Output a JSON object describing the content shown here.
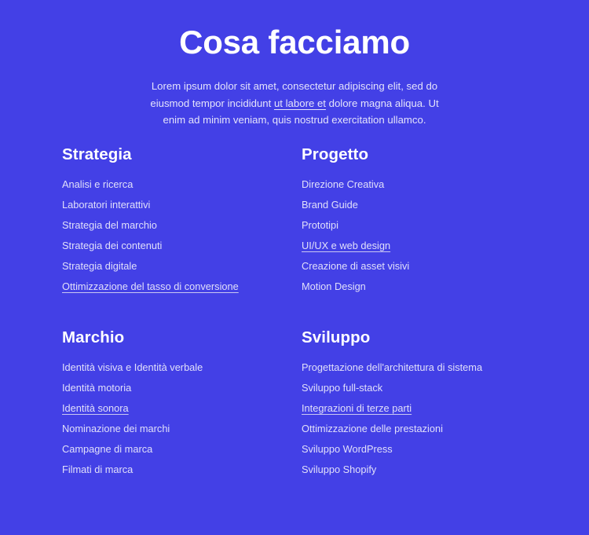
{
  "header": {
    "title": "Cosa facciamo",
    "intro_before": "Lorem ipsum dolor sit amet, consectetur adipiscing elit, sed do eiusmod tempor incididunt ",
    "intro_link": "ut labore et",
    "intro_after": " dolore magna aliqua. Ut enim ad minim veniam, quis nostrud exercitation ullamco."
  },
  "colors": {
    "background": "#4340e6",
    "heading_text": "#ffffff",
    "body_text": "#e4e3fb",
    "item_text": "#e0dffa",
    "underline": "#c9c7f2"
  },
  "groups": [
    {
      "title": "Strategia",
      "items": [
        {
          "label": "Analisi e ricerca",
          "underlined": false
        },
        {
          "label": "Laboratori interattivi",
          "underlined": false
        },
        {
          "label": "Strategia del marchio",
          "underlined": false
        },
        {
          "label": "Strategia dei contenuti",
          "underlined": false
        },
        {
          "label": "Strategia digitale",
          "underlined": false
        },
        {
          "label": "Ottimizzazione del tasso di conversione",
          "underlined": true
        }
      ]
    },
    {
      "title": "Progetto",
      "items": [
        {
          "label": "Direzione Creativa",
          "underlined": false
        },
        {
          "label": "Brand Guide",
          "underlined": false
        },
        {
          "label": "Prototipi",
          "underlined": false
        },
        {
          "label": "UI/UX e web design",
          "underlined": true
        },
        {
          "label": "Creazione di asset visivi",
          "underlined": false
        },
        {
          "label": "Motion Design",
          "underlined": false
        }
      ]
    },
    {
      "title": "Marchio",
      "items": [
        {
          "label": "Identità visiva e Identità verbale",
          "underlined": false
        },
        {
          "label": "Identità motoria",
          "underlined": false
        },
        {
          "label": "Identità sonora",
          "underlined": true
        },
        {
          "label": "Nominazione dei marchi",
          "underlined": false
        },
        {
          "label": "Campagne di marca",
          "underlined": false
        },
        {
          "label": "Filmati di marca",
          "underlined": false
        }
      ]
    },
    {
      "title": "Sviluppo",
      "items": [
        {
          "label": "Progettazione dell'architettura di sistema",
          "underlined": false
        },
        {
          "label": "Sviluppo full-stack",
          "underlined": false
        },
        {
          "label": "Integrazioni di terze parti",
          "underlined": true
        },
        {
          "label": "Ottimizzazione delle prestazioni",
          "underlined": false
        },
        {
          "label": "Sviluppo WordPress",
          "underlined": false
        },
        {
          "label": "Sviluppo Shopify",
          "underlined": false
        }
      ]
    }
  ]
}
